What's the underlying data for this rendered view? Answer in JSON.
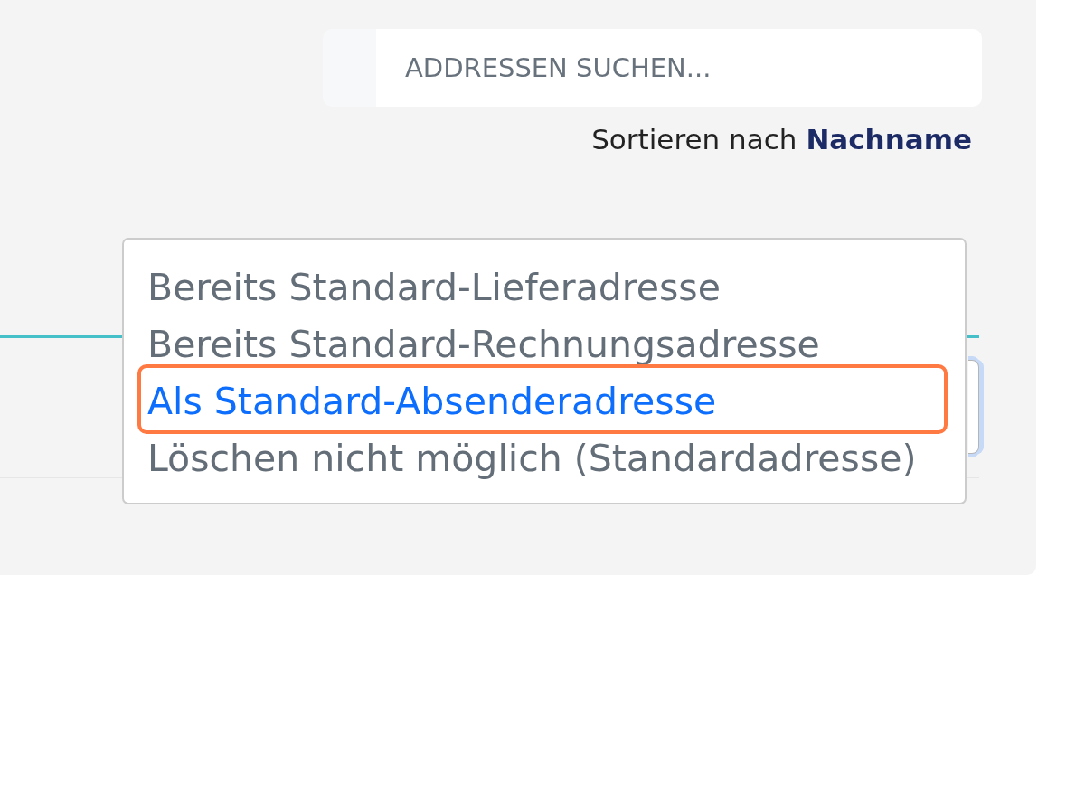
{
  "search": {
    "placeholder": "ADDRESSEN SUCHEN..."
  },
  "sort": {
    "label": "Sortieren nach",
    "value": "Nachname"
  },
  "menu": {
    "items": [
      {
        "label": "Bereits Standard-Lieferadresse",
        "disabled": true,
        "highlighted": false
      },
      {
        "label": "Bereits Standard-Rechnungsadresse",
        "disabled": true,
        "highlighted": false
      },
      {
        "label": "Als Standard-Absenderadresse",
        "disabled": false,
        "highlighted": true
      },
      {
        "label": "Löschen nicht möglich (Standardadresse)",
        "disabled": true,
        "highlighted": false
      }
    ]
  }
}
